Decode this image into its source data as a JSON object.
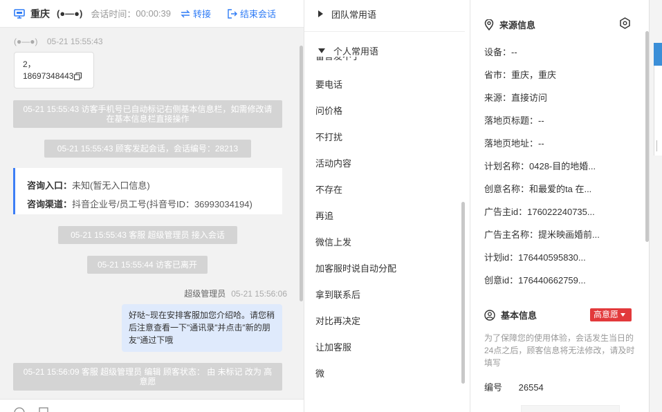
{
  "header": {
    "city": "重庆",
    "visitor_tag": "(●—●)",
    "timer_label": "会话时间：",
    "timer": "00:00:39",
    "transfer": "转接",
    "end": "结束会话"
  },
  "chat": {
    "visitor_meta": {
      "name": "(●—●)",
      "time": "05-21 15:55:43"
    },
    "phone_card": {
      "line1": "2，",
      "line2": "18697348443"
    },
    "system_1": "05-21 15:55:43 访客手机号已自动标记右侧基本信息栏，如需修改请在基本信息栏直接操作",
    "system_2": "05-21 15:55:43 顾客发起会话，会话编号：28213",
    "entry_label": "咨询入口：",
    "entry_value": "未知(暂无入口信息)",
    "channel_label": "咨询渠道：",
    "channel_value": "抖音企业号/员工号(抖音号ID：36993034194)",
    "system_3": "05-21 15:55:43 客服 超级管理员 接入会话",
    "system_4": "05-21 15:55:44 访客已离开",
    "agent_name": "超级管理员",
    "agent_time": "05-21 15:56:06",
    "agent_msg": "好哒~现在安排客服加您介绍哈。请您稍后注意查看一下\"通讯录\"并点击\"新的朋友\"通过下哦",
    "system_5": "05-21 15:56:09 客服 超级管理员 编辑 顾客状态： 由 未标记 改为 高意愿"
  },
  "phrases": {
    "group_team": "团队常用语",
    "group_personal": "个人常用语",
    "cut_item": "留言发不了",
    "items": [
      "要电话",
      "问价格",
      "不打扰",
      "活动内容",
      "不存在",
      "再追",
      "微信上发",
      "加客服时说自动分配",
      "拿到联系后",
      "对比再决定",
      "让加客服",
      "微"
    ]
  },
  "info": {
    "source_title": "来源信息",
    "device": "设备：--",
    "province": "省市：重庆，重庆",
    "source": "来源：直接访问",
    "landing_title": "落地页标题：--",
    "landing_url": "落地页地址：--",
    "plan_name": "计划名称：0428-目的地婚...",
    "creative_name": "创意名称：和最爱的ta 在...",
    "advertiser_id": "广告主id：176022240735...",
    "advertiser_name": "广告主名称：提米映画婚前...",
    "plan_id": "计划id：176440595830...",
    "creative_id": "创意id：176440662759...",
    "basic_title": "基本信息",
    "intent_badge": "高意愿",
    "hint": "为了保障您的使用体验，会话发生当日的24点之后，顾客信息将无法修改，请及时填写",
    "number_label": "编号",
    "number_value": "26554"
  },
  "colors": {
    "accent": "#2f7cf6",
    "badge": "#e2393b",
    "system_bg": "#d4d4d4",
    "bubble_bg": "#dfeafc"
  }
}
